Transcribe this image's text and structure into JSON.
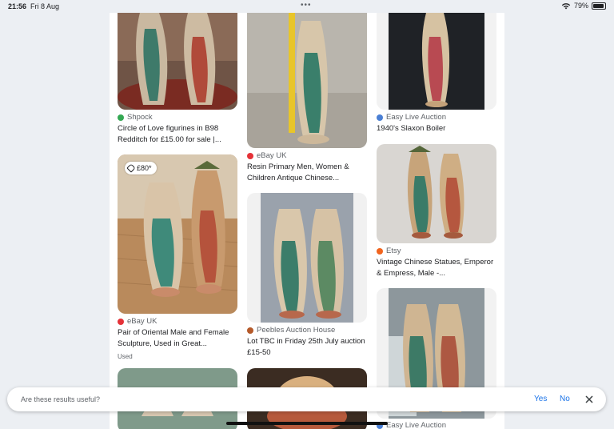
{
  "status_bar": {
    "time": "21:56",
    "date": "Fri 8 Aug",
    "dots": "•••",
    "battery": "79%"
  },
  "results": [
    {
      "source": "Shpock",
      "source_color": "#34a853",
      "title": "Circle of Love figurines in B98 Redditch for £15.00 for sale |..."
    },
    {
      "source": "eBay UK",
      "source_color": "#e53238",
      "title": "Resin Primary Men, Women & Children Antique Chinese..."
    },
    {
      "source": "Easy Live Auction",
      "source_color": "#4a7fd4",
      "title": "1940's Slaxon Boiler"
    },
    {
      "source": "eBay UK",
      "source_color": "#e53238",
      "title": "Pair of Oriental Male and Female Sculpture, Used in Great...",
      "price": "£80*",
      "condition": "Used"
    },
    {
      "source": "Peebles Auction House",
      "source_color": "#b55a2a",
      "title": "Lot TBC in Friday 25th July auction £15-50"
    },
    {
      "source": "Etsy",
      "source_color": "#f1641e",
      "title": "Vintage Chinese Statues, Emperor & Empress, Male -..."
    },
    {
      "source": "Easy Live Auction",
      "source_color": "#4a7fd4"
    }
  ],
  "feedback": {
    "question": "Are these results useful?",
    "yes": "Yes",
    "no": "No"
  }
}
